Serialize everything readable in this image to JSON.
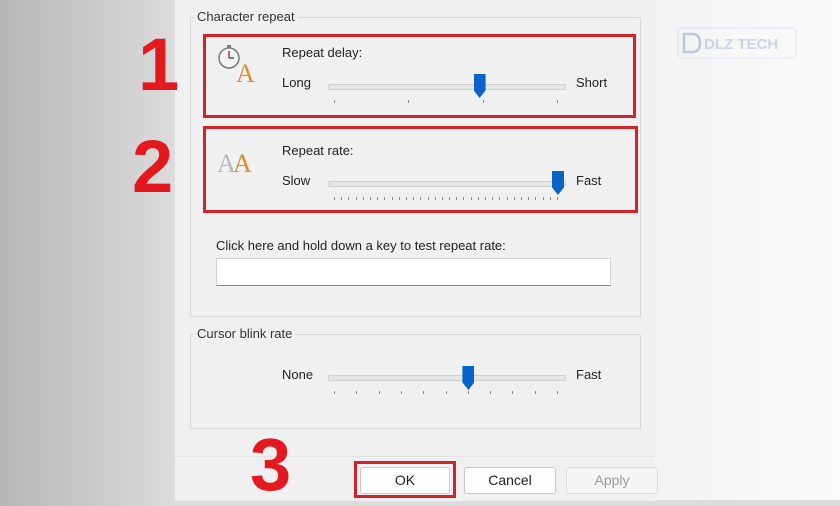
{
  "character_repeat": {
    "group_label": "Character repeat",
    "repeat_delay": {
      "label": "Repeat delay:",
      "min_label": "Long",
      "max_label": "Short",
      "value_fraction": 0.65,
      "ticks": 4
    },
    "repeat_rate": {
      "label": "Repeat rate:",
      "min_label": "Slow",
      "max_label": "Fast",
      "value_fraction": 1.0,
      "ticks": 32
    },
    "test": {
      "label": "Click here and hold down a key to test repeat rate:",
      "value": ""
    }
  },
  "cursor_blink": {
    "group_label": "Cursor blink rate",
    "min_label": "None",
    "max_label": "Fast",
    "value_fraction": 0.6,
    "ticks": 11
  },
  "buttons": {
    "ok": "OK",
    "cancel": "Cancel",
    "apply": "Apply"
  },
  "annotations": {
    "step1": "1",
    "step2": "2",
    "step3": "3"
  },
  "watermark": {
    "text": "DLZ TECH"
  },
  "icons": {
    "repeat_delay": "stopwatch-letter-icon",
    "repeat_rate": "double-letter-icon"
  },
  "colors": {
    "accent": "#0a64c8",
    "highlight": "#d3222a",
    "marker": "#e3191f"
  }
}
